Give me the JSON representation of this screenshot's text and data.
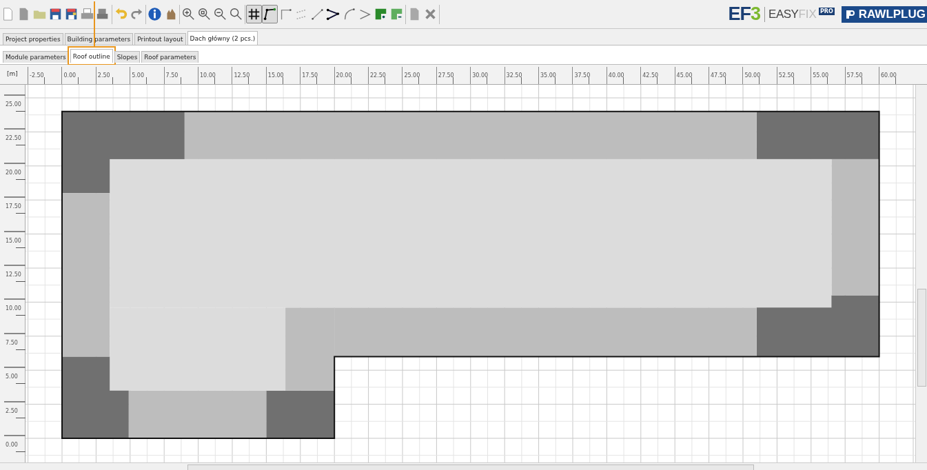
{
  "toolbar": {
    "toggles": [
      {
        "active": true
      },
      {
        "active": true
      }
    ]
  },
  "logo": {
    "ef": "EF",
    "three": "3",
    "easy": "EASY",
    "fix": "FIX",
    "pro": "PRO",
    "brand": "RAWLPLUG"
  },
  "tabs": [
    {
      "label": "Project properties",
      "selected": false
    },
    {
      "label": "Building parameters",
      "selected": false
    },
    {
      "label": "Printout layout",
      "selected": false
    },
    {
      "label": "Dach główny (2 pcs.)",
      "selected": true
    }
  ],
  "subtabs": [
    {
      "label": "Module parameters",
      "selected": false,
      "highlighted": false
    },
    {
      "label": "Roof outline",
      "selected": true,
      "highlighted": true
    },
    {
      "label": "Slopes",
      "selected": false,
      "highlighted": false
    },
    {
      "label": "Roof parameters",
      "selected": false,
      "highlighted": false
    }
  ],
  "ruler": {
    "unit": "[m]",
    "x_labels": [
      "-2.50",
      "0.00",
      "2.50",
      "5.00",
      "7.50",
      "10.00",
      "12.50",
      "15.00",
      "17.50",
      "20.00",
      "22.50",
      "25.00",
      "27.50",
      "30.00",
      "32.50",
      "35.00",
      "37.50",
      "40.00",
      "42.50",
      "45.00",
      "47.50",
      "50.00",
      "52.50",
      "55.00",
      "57.50",
      "60.00"
    ],
    "y_labels": [
      "25.00",
      "22.50",
      "20.00",
      "17.50",
      "15.00",
      "12.50",
      "10.00",
      "7.50",
      "5.00",
      "2.50",
      "0.00"
    ]
  }
}
